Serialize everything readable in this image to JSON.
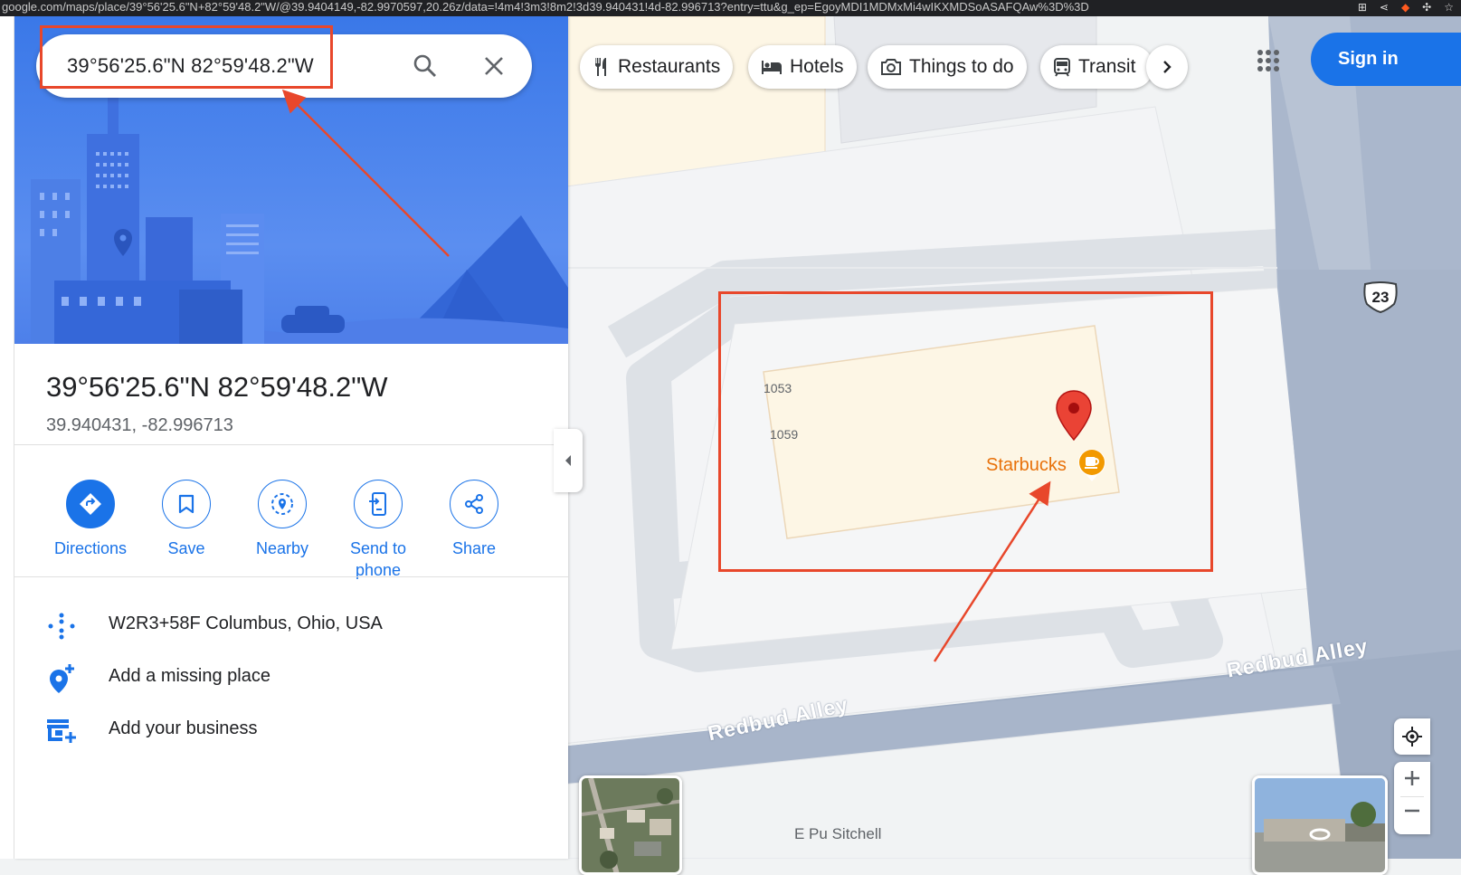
{
  "browser": {
    "url": "google.com/maps/place/39°56'25.6\"N+82°59'48.2\"W/@39.9404149,-82.9970597,20.26z/data=!4m4!3m3!8m2!3d39.940431!4d-82.996713?entry=ttu&g_ep=EgoyMDI1MDMxMi4wIKXMDSoASAFQAw%3D%3D"
  },
  "search": {
    "query": "39°56'25.6\"N 82°59'48.2\"W"
  },
  "place": {
    "title": "39°56'25.6\"N 82°59'48.2\"W",
    "decimal_coords": "39.940431, -82.996713"
  },
  "actions": [
    {
      "label": "Directions",
      "icon": "directions-icon"
    },
    {
      "label": "Save",
      "icon": "bookmark-icon"
    },
    {
      "label": "Nearby",
      "icon": "nearby-icon"
    },
    {
      "label": "Send to phone",
      "icon": "send-to-phone-icon"
    },
    {
      "label": "Share",
      "icon": "share-icon"
    }
  ],
  "info_rows": [
    {
      "text": "W2R3+58F Columbus, Ohio, USA",
      "icon": "plus-code-icon"
    },
    {
      "text": "Add a missing place",
      "icon": "add-place-icon"
    },
    {
      "text": "Add your business",
      "icon": "add-business-icon"
    }
  ],
  "chips": [
    {
      "label": "Restaurants",
      "icon": "restaurant-icon"
    },
    {
      "label": "Hotels",
      "icon": "hotel-icon"
    },
    {
      "label": "Things to do",
      "icon": "camera-icon"
    },
    {
      "label": "Transit",
      "icon": "transit-icon"
    }
  ],
  "header": {
    "sign_in_label": "Sign in"
  },
  "map": {
    "address_labels": [
      "1053",
      "1059"
    ],
    "poi_name": "Starbucks",
    "street_name_1": "Redbud Alley",
    "street_name_2": "Redbud Alley",
    "route_shield": "23",
    "partial_street_label": "E Pu Sitchell"
  },
  "colors": {
    "accent_blue": "#1a73e8",
    "annotation_red": "#e8472b",
    "poi_orange": "#e8710a",
    "pin_red": "#ea4335"
  }
}
